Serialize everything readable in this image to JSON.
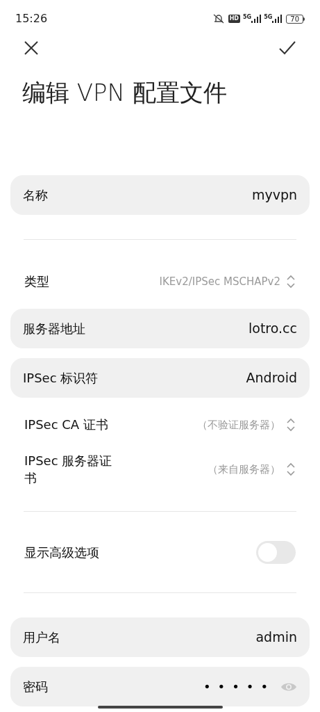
{
  "status_bar": {
    "time": "15:26",
    "hd": "HD",
    "sim1": "5G",
    "sim2": "5G",
    "battery": "70"
  },
  "title": "编辑 VPN 配置文件",
  "rows": [
    {
      "kind": "field",
      "label": "名称",
      "value": "myvpn"
    },
    {
      "kind": "divider"
    },
    {
      "kind": "select",
      "label": "类型",
      "value": "IKEv2/IPSec MSCHAPv2"
    },
    {
      "kind": "field",
      "label": "服务器地址",
      "value": "lotro.cc"
    },
    {
      "kind": "field",
      "label": "IPSec 标识符",
      "value": "Android"
    },
    {
      "kind": "select",
      "label": "IPSec CA 证书",
      "value": "（不验证服务器）"
    },
    {
      "kind": "select",
      "label": "IPSec 服务器证书",
      "value": "（来自服务器）"
    },
    {
      "kind": "divider"
    },
    {
      "kind": "toggle",
      "label": "显示高级选项",
      "on": false
    },
    {
      "kind": "divider"
    },
    {
      "kind": "field",
      "label": "用户名",
      "value": "admin"
    },
    {
      "kind": "password",
      "label": "密码",
      "value": "•••••"
    }
  ]
}
